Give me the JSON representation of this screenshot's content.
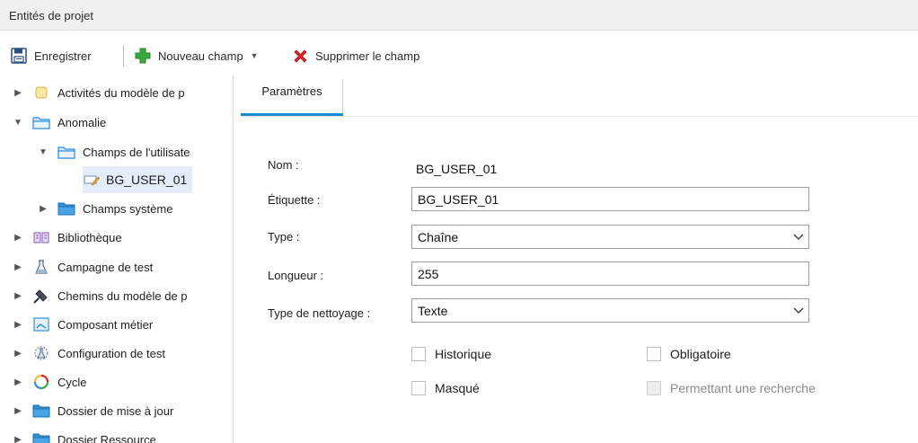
{
  "window": {
    "title": "Entités de projet"
  },
  "toolbar": {
    "save_label": "Enregistrer",
    "new_field_label": "Nouveau champ",
    "delete_field_label": "Supprimer le champ"
  },
  "tree": {
    "items": [
      {
        "label": "Activités du modèle de p",
        "icon": "activity-icon",
        "expanded": false
      },
      {
        "label": "Anomalie",
        "icon": "folder-icon",
        "expanded": true
      },
      {
        "label": "Champs de l'utilisate",
        "icon": "folder-icon",
        "expanded": true
      },
      {
        "label": "BG_USER_01",
        "icon": "field-edit-icon",
        "selected": true
      },
      {
        "label": "Champs système",
        "icon": "folder-icon",
        "expanded": false
      },
      {
        "label": "Bibliothèque",
        "icon": "library-icon",
        "expanded": false
      },
      {
        "label": "Campagne de test",
        "icon": "test-set-icon",
        "expanded": false
      },
      {
        "label": "Chemins du modèle de p",
        "icon": "path-icon",
        "expanded": false
      },
      {
        "label": "Composant métier",
        "icon": "component-icon",
        "expanded": false
      },
      {
        "label": "Configuration de test",
        "icon": "test-config-icon",
        "expanded": false
      },
      {
        "label": "Cycle",
        "icon": "cycle-icon",
        "expanded": false
      },
      {
        "label": "Dossier de mise à jour",
        "icon": "folder-icon",
        "expanded": false
      },
      {
        "label": "Dossier Ressource",
        "icon": "folder-icon",
        "expanded": false
      }
    ]
  },
  "tabs": [
    {
      "label": "Paramètres",
      "active": true
    }
  ],
  "form": {
    "name_label": "Nom :",
    "name_value": "BG_USER_01",
    "label_label": "Étiquette :",
    "label_value": "BG_USER_01",
    "type_label": "Type :",
    "type_value": "Chaîne",
    "length_label": "Longueur :",
    "length_value": "255",
    "cleanup_label": "Type de nettoyage :",
    "cleanup_value": "Texte"
  },
  "checkboxes": {
    "history": {
      "label": "Historique",
      "checked": false
    },
    "required": {
      "label": "Obligatoire",
      "checked": false
    },
    "masked": {
      "label": "Masqué",
      "checked": false
    },
    "searchable": {
      "label": "Permettant une recherche",
      "checked": false,
      "disabled": true
    }
  },
  "colors": {
    "accent": "#1a8ad4",
    "folder": "#2f8fd8",
    "delete": "#e0262b",
    "add": "#3aa83a"
  }
}
